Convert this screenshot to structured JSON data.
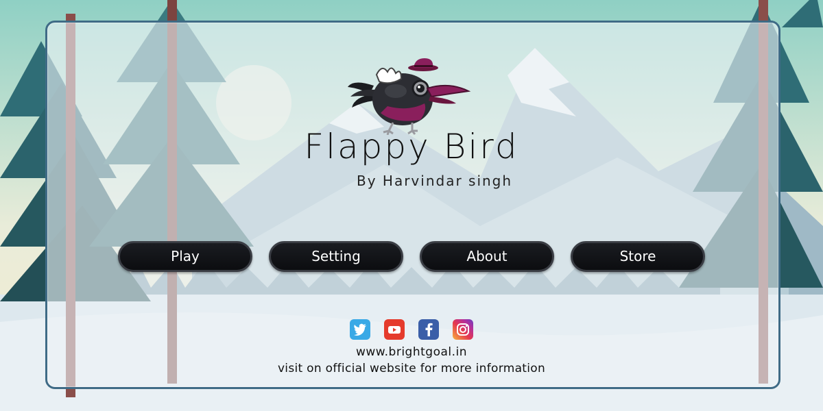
{
  "game": {
    "title": "Flappy Bird",
    "subtitle": "By Harvindar singh"
  },
  "menu": {
    "play_label": "Play",
    "setting_label": "Setting",
    "about_label": "About",
    "store_label": "Store"
  },
  "social": {
    "icons": [
      "twitter-icon",
      "youtube-icon",
      "facebook-icon",
      "instagram-icon"
    ],
    "website": "www.brightgoal.in",
    "message": "visit on official website for more information"
  },
  "colors": {
    "panel_border": "#3f6b86",
    "button_bg": "#0c0d10",
    "bird_accent": "#8a1f5c",
    "twitter": "#39a9e6",
    "youtube": "#e53b2c",
    "facebook": "#3a5ea8"
  }
}
